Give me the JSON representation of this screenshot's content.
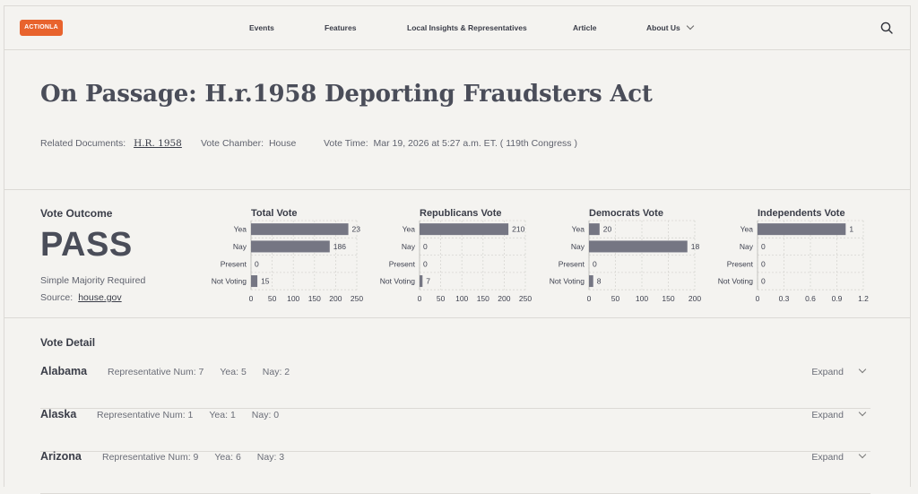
{
  "brand": {
    "logo_text": "ACTIONLA OVA",
    "color": "#e8632d"
  },
  "nav": {
    "items": [
      "Events",
      "Features",
      "Local Insights & Representatives",
      "Article",
      "About Us"
    ]
  },
  "page": {
    "title": "On Passage: H.r.1958 Deporting Fraudsters Act",
    "related_label": "Related Documents:",
    "related_link": "H.R. 1958",
    "chamber_label": "Vote Chamber:",
    "chamber_value": "House",
    "time_label": "Vote Time:",
    "time_value": "Mar 19, 2026 at 5:27 a.m. ET. ( 119th Congress )"
  },
  "outcome": {
    "label": "Vote Outcome",
    "result": "PASS",
    "requirement": "Simple Majority Required",
    "source_label": "Source:",
    "source_link": "house.gov"
  },
  "chart_data": [
    {
      "type": "bar",
      "title": "Total Vote",
      "categories": [
        "Yea",
        "Nay",
        "Present",
        "Not Voting"
      ],
      "values": [
        230,
        186,
        0,
        15
      ],
      "value_labels": [
        "23",
        "186",
        "0",
        "15"
      ],
      "xlim": [
        0,
        250
      ],
      "ticks": [
        "0",
        "50",
        "100",
        "150",
        "200",
        "250"
      ]
    },
    {
      "type": "bar",
      "title": "Republicans Vote",
      "categories": [
        "Yea",
        "Nay",
        "Present",
        "Not Voting"
      ],
      "values": [
        210,
        0,
        0,
        7
      ],
      "value_labels": [
        "210",
        "0",
        "0",
        "7"
      ],
      "xlim": [
        0,
        250
      ],
      "ticks": [
        "0",
        "50",
        "100",
        "150",
        "200",
        "250"
      ]
    },
    {
      "type": "bar",
      "title": "Democrats Vote",
      "categories": [
        "Yea",
        "Nay",
        "Present",
        "Not Voting"
      ],
      "values": [
        20,
        186,
        0,
        8
      ],
      "value_labels": [
        "20",
        "18",
        "0",
        "8"
      ],
      "xlim": [
        0,
        200
      ],
      "ticks": [
        "0",
        "50",
        "100",
        "150",
        "200"
      ]
    },
    {
      "type": "bar",
      "title": "Independents Vote",
      "categories": [
        "Yea",
        "Nay",
        "Present",
        "Not Voting"
      ],
      "values": [
        1,
        0,
        0,
        0
      ],
      "value_labels": [
        "1",
        "0",
        "0",
        "0"
      ],
      "xlim": [
        0,
        1.2
      ],
      "ticks": [
        "0",
        "0.3",
        "0.6",
        "0.9",
        "1.2"
      ]
    }
  ],
  "bar_color": "#757683",
  "detail": {
    "label": "Vote Detail",
    "expand_label": "Expand",
    "states": [
      {
        "name": "Alabama",
        "reps": "Representative Num: 7",
        "yea": "Yea: 5",
        "nay": "Nay: 2"
      },
      {
        "name": "Alaska",
        "reps": "Representative Num: 1",
        "yea": "Yea: 1",
        "nay": "Nay: 0"
      },
      {
        "name": "Arizona",
        "reps": "Representative Num: 9",
        "yea": "Yea: 6",
        "nay": "Nay: 3"
      }
    ]
  }
}
